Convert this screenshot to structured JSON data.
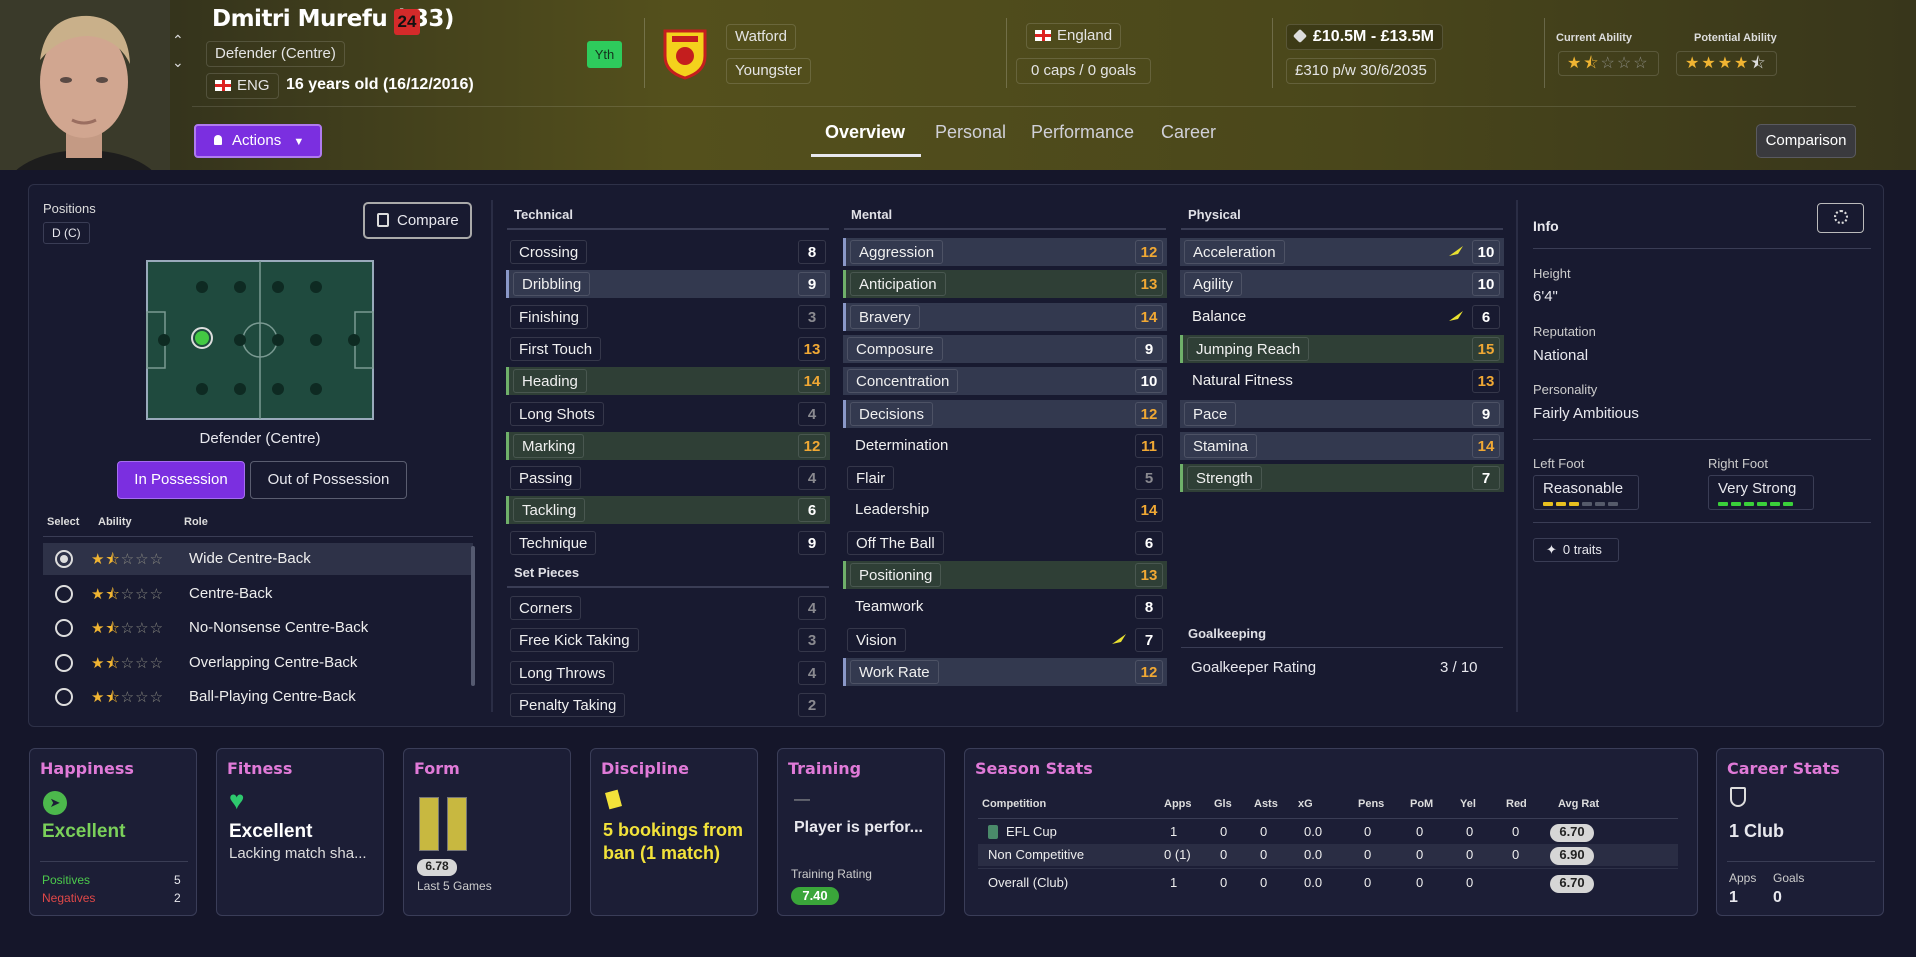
{
  "player": {
    "name": "Dmitri Murefu (I33)",
    "squad_number": "24",
    "position": "Defender (Centre)",
    "nationality_code": "ENG",
    "age": "16 years old (16/12/2016)",
    "youth_badge": "Yth",
    "club": "Watford",
    "status": "Youngster",
    "nation": "England",
    "caps": "0 caps / 0 goals",
    "value": "£10.5M - £13.5M",
    "wage": "£310 p/w",
    "contract": "30/6/2035",
    "current_ability_label": "Current Ability",
    "potential_ability_label": "Potential Ability",
    "current_ability_stars": 1.5,
    "potential_ability_stars": 4.5
  },
  "header": {
    "actions_label": "Actions",
    "comparison_label": "Comparison",
    "tabs": [
      "Overview",
      "Personal",
      "Performance",
      "Career"
    ]
  },
  "positions": {
    "title": "Positions",
    "badge": "D (C)",
    "compare_label": "Compare",
    "pitch_label": "Defender (Centre)",
    "in_possession": "In Possession",
    "out_possession": "Out of Possession",
    "col_select": "Select",
    "col_ability": "Ability",
    "col_role": "Role",
    "roles": [
      {
        "name": "Wide Centre-Back",
        "selected": true,
        "stars": 1.5
      },
      {
        "name": "Centre-Back",
        "selected": false,
        "stars": 1.5
      },
      {
        "name": "No-Nonsense Centre-Back",
        "selected": false,
        "stars": 1.5
      },
      {
        "name": "Overlapping Centre-Back",
        "selected": false,
        "stars": 1.5
      },
      {
        "name": "Ball-Playing Centre-Back",
        "selected": false,
        "stars": 1.5
      }
    ]
  },
  "technical": {
    "title": "Technical",
    "items": [
      {
        "l": "Crossing",
        "v": "8"
      },
      {
        "l": "Dribbling",
        "v": "9"
      },
      {
        "l": "Finishing",
        "v": "3"
      },
      {
        "l": "First Touch",
        "v": "13"
      },
      {
        "l": "Heading",
        "v": "14"
      },
      {
        "l": "Long Shots",
        "v": "4"
      },
      {
        "l": "Marking",
        "v": "12"
      },
      {
        "l": "Passing",
        "v": "4"
      },
      {
        "l": "Tackling",
        "v": "6"
      },
      {
        "l": "Technique",
        "v": "9"
      }
    ]
  },
  "setpieces": {
    "title": "Set Pieces",
    "items": [
      {
        "l": "Corners",
        "v": "4"
      },
      {
        "l": "Free Kick Taking",
        "v": "3"
      },
      {
        "l": "Long Throws",
        "v": "4"
      },
      {
        "l": "Penalty Taking",
        "v": "2"
      }
    ]
  },
  "mental": {
    "title": "Mental",
    "items": [
      {
        "l": "Aggression",
        "v": "12"
      },
      {
        "l": "Anticipation",
        "v": "13"
      },
      {
        "l": "Bravery",
        "v": "14"
      },
      {
        "l": "Composure",
        "v": "9"
      },
      {
        "l": "Concentration",
        "v": "10"
      },
      {
        "l": "Decisions",
        "v": "12"
      },
      {
        "l": "Determination",
        "v": "11"
      },
      {
        "l": "Flair",
        "v": "5"
      },
      {
        "l": "Leadership",
        "v": "14"
      },
      {
        "l": "Off The Ball",
        "v": "6"
      },
      {
        "l": "Positioning",
        "v": "13"
      },
      {
        "l": "Teamwork",
        "v": "8"
      },
      {
        "l": "Vision",
        "v": "7"
      },
      {
        "l": "Work Rate",
        "v": "12"
      }
    ]
  },
  "physical": {
    "title": "Physical",
    "items": [
      {
        "l": "Acceleration",
        "v": "10"
      },
      {
        "l": "Agility",
        "v": "10"
      },
      {
        "l": "Balance",
        "v": "6"
      },
      {
        "l": "Jumping Reach",
        "v": "15"
      },
      {
        "l": "Natural Fitness",
        "v": "13"
      },
      {
        "l": "Pace",
        "v": "9"
      },
      {
        "l": "Stamina",
        "v": "14"
      },
      {
        "l": "Strength",
        "v": "7"
      }
    ]
  },
  "goalkeeping": {
    "title": "Goalkeeping",
    "label": "Goalkeeper Rating",
    "value": "3 / 10"
  },
  "info": {
    "title": "Info",
    "height_label": "Height",
    "height": "6'4\"",
    "reputation_label": "Reputation",
    "reputation": "National",
    "personality_label": "Personality",
    "personality": "Fairly Ambitious",
    "left_foot_label": "Left Foot",
    "left_foot": "Reasonable",
    "left_foot_level": 3,
    "right_foot_label": "Right Foot",
    "right_foot": "Very Strong",
    "right_foot_level": 6,
    "traits": "0 traits"
  },
  "cards": {
    "happiness": {
      "title": "Happiness",
      "value": "Excellent",
      "positives_label": "Positives",
      "positives": "5",
      "negatives_label": "Negatives",
      "negatives": "2"
    },
    "fitness": {
      "title": "Fitness",
      "value": "Excellent",
      "sub": "Lacking match sha..."
    },
    "form": {
      "title": "Form",
      "rating": "6.78",
      "sub": "Last 5 Games"
    },
    "discipline": {
      "title": "Discipline",
      "text": "5 bookings from ban (1 match)"
    },
    "training": {
      "title": "Training",
      "dash": "—",
      "text": "Player is perfor...",
      "rating_label": "Training Rating",
      "rating": "7.40"
    },
    "season": {
      "title": "Season Stats",
      "headers": [
        "Competition",
        "Apps",
        "Gls",
        "Asts",
        "xG",
        "Pens",
        "PoM",
        "Yel",
        "Red",
        "Avg Rat"
      ],
      "rows": [
        [
          "EFL Cup",
          "1",
          "0",
          "0",
          "0.0",
          "0",
          "0",
          "0",
          "0",
          "6.70"
        ],
        [
          "Non Competitive",
          "0 (1)",
          "0",
          "0",
          "0.0",
          "0",
          "0",
          "0",
          "0",
          "6.90"
        ],
        [
          "Overall (Club)",
          "1",
          "0",
          "0",
          "0.0",
          "0",
          "0",
          "0",
          "",
          "6.70"
        ]
      ]
    },
    "career": {
      "title": "Career Stats",
      "clubs": "1 Club",
      "apps_label": "Apps",
      "apps": "1",
      "goals_label": "Goals",
      "goals": "0"
    }
  },
  "colors": {
    "accent": "#7b2fe0",
    "value_orange": "#f0a834",
    "value_grey": "#8a8a90",
    "value_white": "#ffffff",
    "positive": "#4cc94c",
    "negative": "#e04848",
    "pink_title": "#e07ad8"
  }
}
